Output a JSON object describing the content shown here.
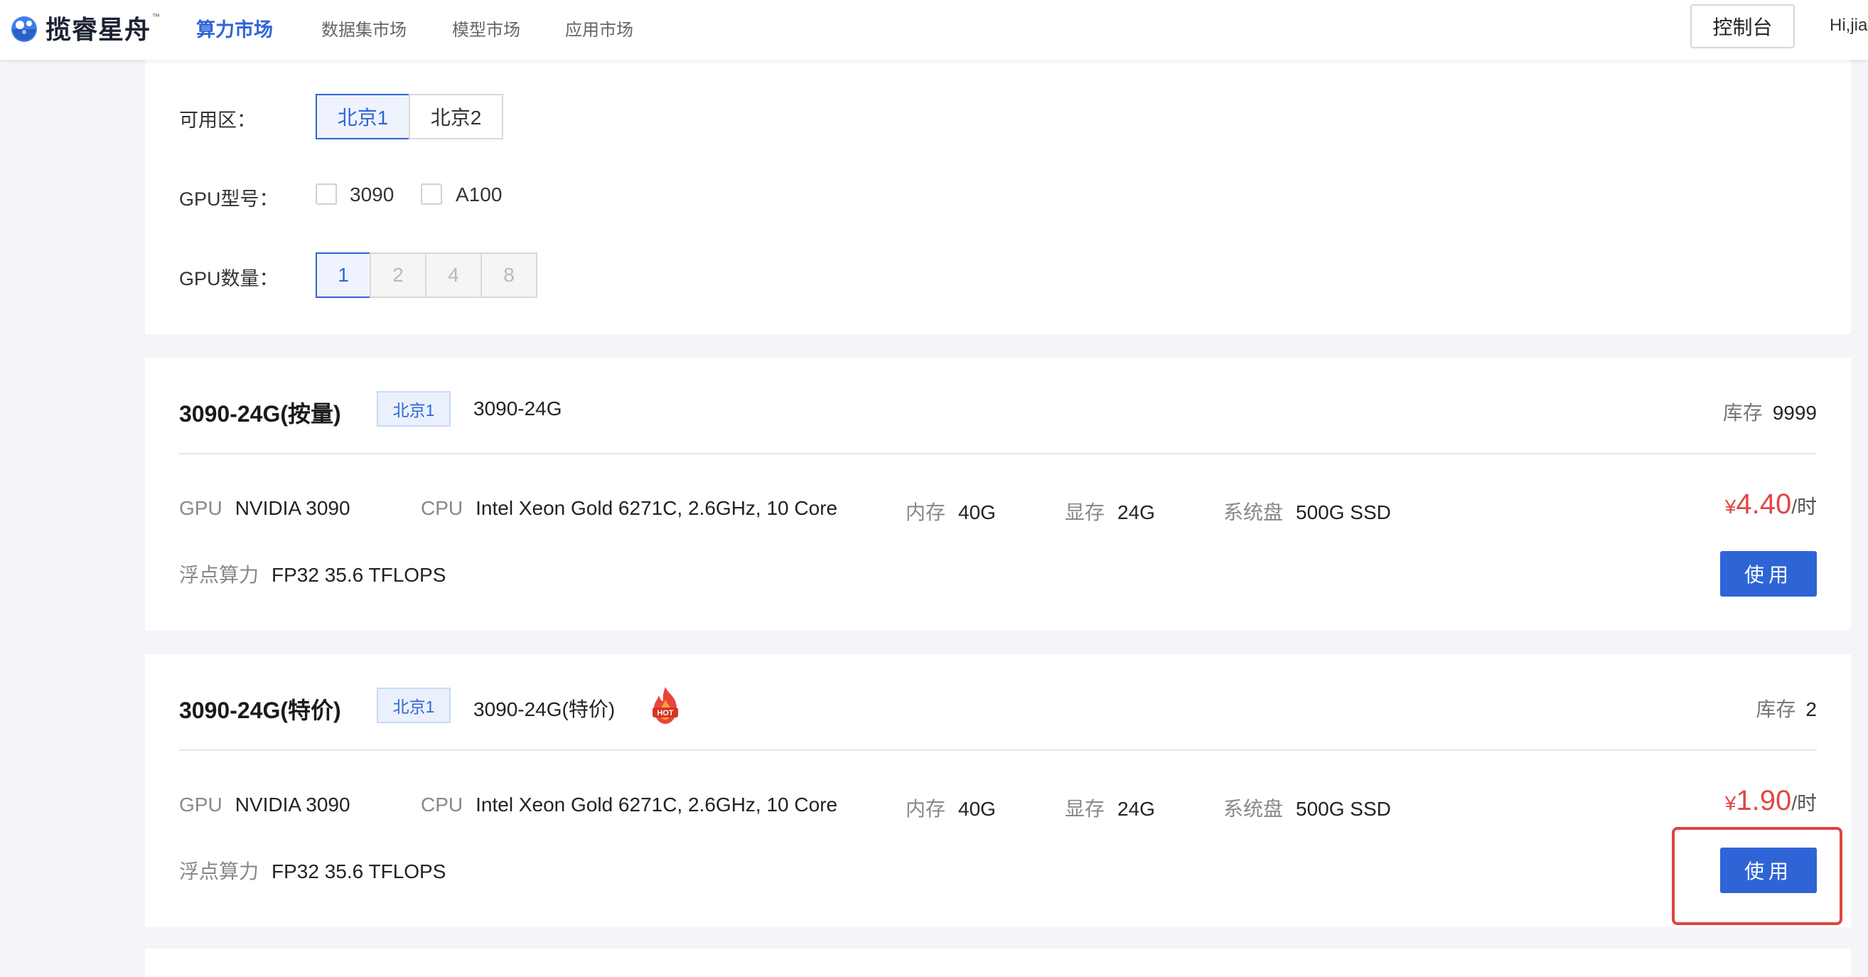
{
  "header": {
    "brand": "揽睿星舟",
    "brand_tm": "™",
    "nav": [
      "算力市场",
      "数据集市场",
      "模型市场",
      "应用市场"
    ],
    "active_nav": "算力市场",
    "console_label": "控制台",
    "greeting": "Hi,jia"
  },
  "filters": {
    "zone_label": "可用区：",
    "zones": [
      "北京1",
      "北京2"
    ],
    "zone_selected": "北京1",
    "gpu_model_label": "GPU型号：",
    "gpu_models": [
      "3090",
      "A100"
    ],
    "gpu_count_label": "GPU数量：",
    "gpu_counts": [
      "1",
      "2",
      "4",
      "8"
    ],
    "gpu_count_selected": "1"
  },
  "products": [
    {
      "title": "3090-24G(按量)",
      "region": "北京1",
      "model": "3090-24G",
      "hot": false,
      "stock_label": "库存",
      "stock": "9999",
      "gpu_label": "GPU",
      "gpu": "NVIDIA 3090",
      "cpu_label": "CPU",
      "cpu": "Intel Xeon Gold 6271C, 2.6GHz, 10 Core",
      "mem_label": "内存",
      "mem": "40G",
      "vram_label": "显存",
      "vram": "24G",
      "disk_label": "系统盘",
      "disk": "500G SSD",
      "flops_label": "浮点算力",
      "flops": "FP32 35.6 TFLOPS",
      "price_symbol": "¥",
      "price": "4.40",
      "price_unit": "/时",
      "button": "使用"
    },
    {
      "title": "3090-24G(特价)",
      "region": "北京1",
      "model": "3090-24G(特价)",
      "hot": true,
      "hot_text": "HOT",
      "stock_label": "库存",
      "stock": "2",
      "gpu_label": "GPU",
      "gpu": "NVIDIA 3090",
      "cpu_label": "CPU",
      "cpu": "Intel Xeon Gold 6271C, 2.6GHz, 10 Core",
      "mem_label": "内存",
      "mem": "40G",
      "vram_label": "显存",
      "vram": "24G",
      "disk_label": "系统盘",
      "disk": "500G SSD",
      "flops_label": "浮点算力",
      "flops": "FP32 35.6 TFLOPS",
      "price_symbol": "¥",
      "price": "1.90",
      "price_unit": "/时",
      "button": "使用"
    }
  ],
  "colors": {
    "accent": "#2f64d6",
    "price": "#e04747",
    "highlight": "#e0443e"
  }
}
